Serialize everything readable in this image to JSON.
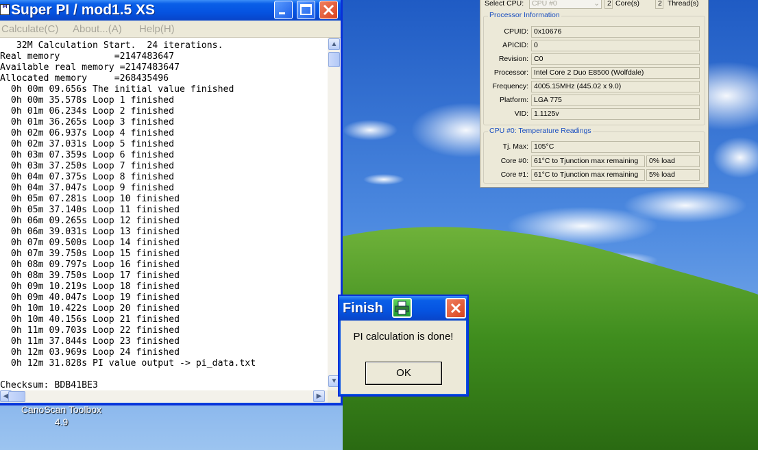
{
  "superpi": {
    "title": "Super PI / mod1.5 XS",
    "icon_text": "PI",
    "menu": [
      {
        "label": "Calculate(C)"
      },
      {
        "label": "About...(A)"
      },
      {
        "label": "Help(H)"
      }
    ],
    "log_lines": [
      "   32M Calculation Start.  24 iterations.",
      "Real memory          =2147483647",
      "Available real memory =2147483647",
      "Allocated memory     =268435496",
      "  0h 00m 09.656s The initial value finished",
      "  0h 00m 35.578s Loop 1 finished",
      "  0h 01m 06.234s Loop 2 finished",
      "  0h 01m 36.265s Loop 3 finished",
      "  0h 02m 06.937s Loop 4 finished",
      "  0h 02m 37.031s Loop 5 finished",
      "  0h 03m 07.359s Loop 6 finished",
      "  0h 03m 37.250s Loop 7 finished",
      "  0h 04m 07.375s Loop 8 finished",
      "  0h 04m 37.047s Loop 9 finished",
      "  0h 05m 07.281s Loop 10 finished",
      "  0h 05m 37.140s Loop 11 finished",
      "  0h 06m 09.265s Loop 12 finished",
      "  0h 06m 39.031s Loop 13 finished",
      "  0h 07m 09.500s Loop 14 finished",
      "  0h 07m 39.750s Loop 15 finished",
      "  0h 08m 09.797s Loop 16 finished",
      "  0h 08m 39.750s Loop 17 finished",
      "  0h 09m 10.219s Loop 18 finished",
      "  0h 09m 40.047s Loop 19 finished",
      "  0h 10m 10.422s Loop 20 finished",
      "  0h 10m 40.156s Loop 21 finished",
      "  0h 11m 09.703s Loop 22 finished",
      "  0h 11m 37.844s Loop 23 finished",
      "  0h 12m 03.969s Loop 24 finished",
      "  0h 12m 31.828s PI value output -> pi_data.txt",
      "",
      "Checksum: BDB41BE3"
    ]
  },
  "cpuz": {
    "select_cpu_label": "Select CPU:",
    "select_cpu_value": "CPU #0",
    "cores_value": "2",
    "cores_label": "Core(s)",
    "threads_value": "2",
    "threads_label": "Thread(s)",
    "processor_info": {
      "legend": "Processor Information",
      "rows": [
        {
          "label": "CPUID:",
          "value": "0x10676"
        },
        {
          "label": "APICID:",
          "value": "0"
        },
        {
          "label": "Revision:",
          "value": "C0"
        },
        {
          "label": "Processor:",
          "value": "Intel Core 2 Duo E8500 (Wolfdale)"
        },
        {
          "label": "Frequency:",
          "value": "4005.15MHz (445.02 x 9.0)"
        },
        {
          "label": "Platform:",
          "value": "LGA 775"
        },
        {
          "label": "VID:",
          "value": "1.1125v"
        }
      ]
    },
    "temperature": {
      "legend": "CPU #0: Temperature Readings",
      "tjmax_label": "Tj. Max:",
      "tjmax_value": "105°C",
      "cores": [
        {
          "label": "Core #0:",
          "value": "61°C to Tjunction max remaining",
          "load": "0% load"
        },
        {
          "label": "Core #1:",
          "value": "61°C to Tjunction max remaining",
          "load": "5% load"
        }
      ]
    }
  },
  "finish_dialog": {
    "title": "Finish",
    "message": "PI calculation is done!",
    "ok_label": "OK"
  },
  "desktop": {
    "icon_label_line1": "CanoScan Toolbox",
    "icon_label_line2": "4.9"
  }
}
